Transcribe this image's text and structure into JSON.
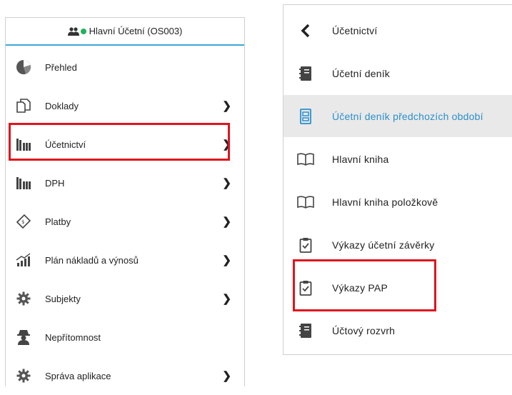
{
  "left_menu": {
    "header_user": "Hlavní Účetní (OS003)",
    "status_color": "#1fb25a",
    "accent_color": "#3aa8d6",
    "items": [
      {
        "label": "Přehled",
        "icon": "pie-chart-icon",
        "has_submenu": false
      },
      {
        "label": "Doklady",
        "icon": "documents-icon",
        "has_submenu": true
      },
      {
        "label": "Účetnictví",
        "icon": "books-icon",
        "has_submenu": true,
        "highlighted": true
      },
      {
        "label": "DPH",
        "icon": "books-icon",
        "has_submenu": true
      },
      {
        "label": "Platby",
        "icon": "payment-ticket-icon",
        "has_submenu": true
      },
      {
        "label": "Plán nákladů a výnosů",
        "icon": "growth-chart-icon",
        "has_submenu": true
      },
      {
        "label": "Subjekty",
        "icon": "gear-icon",
        "has_submenu": true
      },
      {
        "label": "Nepřítomnost",
        "icon": "spy-icon",
        "has_submenu": false
      },
      {
        "label": "Správa aplikace",
        "icon": "gear-icon",
        "has_submenu": true
      }
    ]
  },
  "right_menu": {
    "back_label": "Účetnictví",
    "active_color": "#2b8fcc",
    "items": [
      {
        "label": "Účetní deník",
        "icon": "journal-icon"
      },
      {
        "label": "Účetní deník předchozích období",
        "icon": "archive-journal-icon",
        "active": true
      },
      {
        "label": "Hlavní kniha",
        "icon": "open-book-icon"
      },
      {
        "label": "Hlavní kniha položkově",
        "icon": "open-book-icon"
      },
      {
        "label": "Výkazy účetní závěrky",
        "icon": "clipboard-check-icon"
      },
      {
        "label": "Výkazy PAP",
        "icon": "clipboard-check-icon",
        "highlighted": true
      },
      {
        "label": "Účtový rozvrh",
        "icon": "journal-icon"
      }
    ]
  },
  "highlight_color": "#e0141e"
}
